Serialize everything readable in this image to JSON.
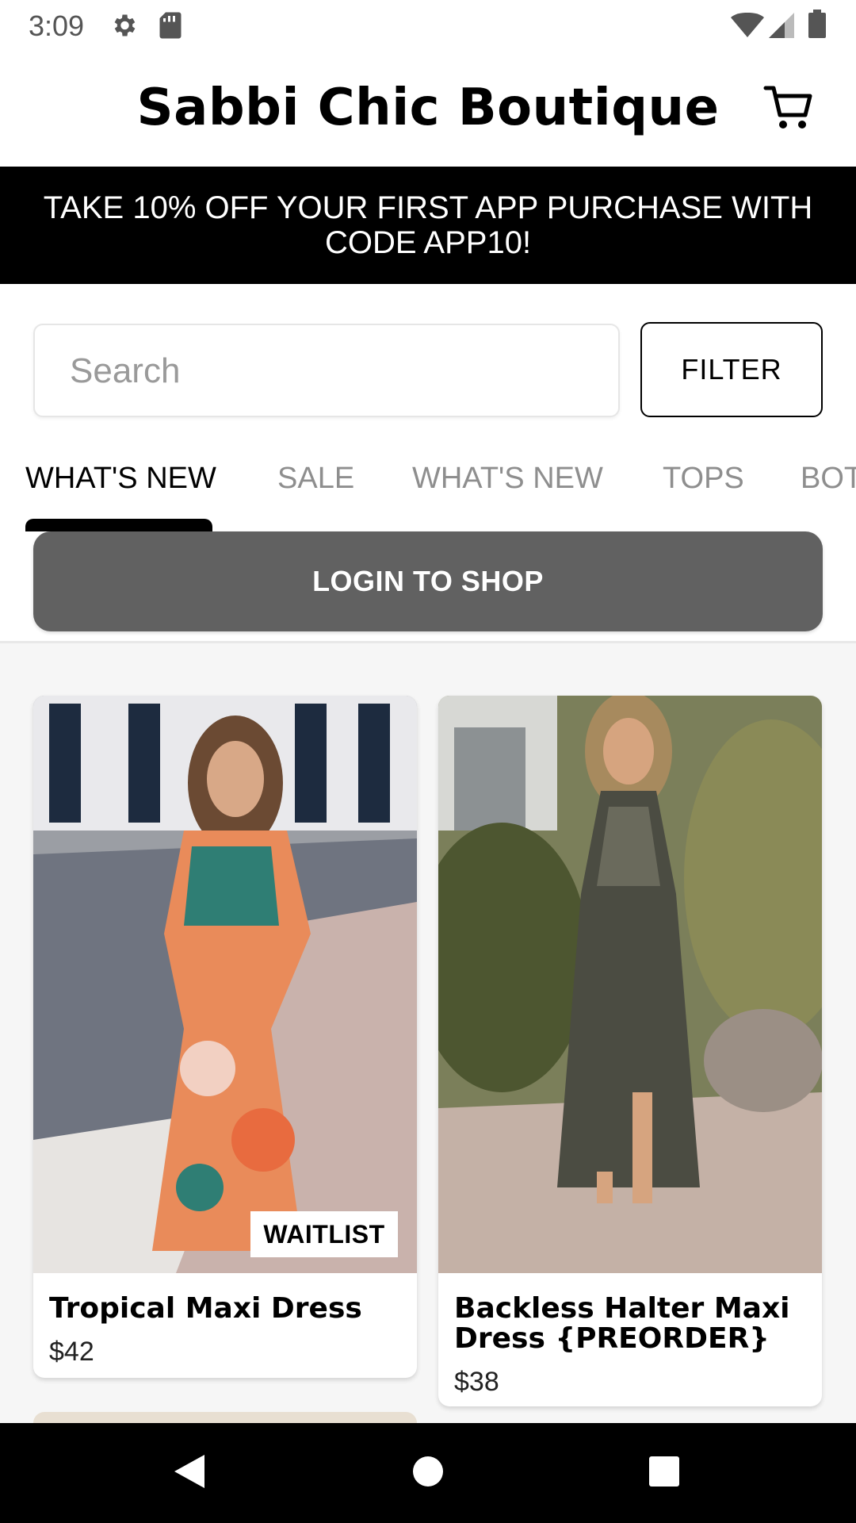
{
  "status_bar": {
    "time": "3:09",
    "icons": [
      "gear-icon",
      "sd-card-icon",
      "wifi-icon",
      "signal-icon",
      "battery-icon"
    ]
  },
  "header": {
    "title": "Sabbi Chic Boutique",
    "cart_icon": "cart-icon"
  },
  "promo": {
    "text": "TAKE 10% OFF YOUR FIRST APP PURCHASE WITH CODE APP10!"
  },
  "search": {
    "placeholder": "Search",
    "value": ""
  },
  "filter": {
    "label": "FILTER"
  },
  "tabs": [
    {
      "label": "WHAT'S NEW",
      "active": true
    },
    {
      "label": "SALE",
      "active": false
    },
    {
      "label": "WHAT'S NEW",
      "active": false
    },
    {
      "label": "TOPS",
      "active": false
    },
    {
      "label": "BOT",
      "active": false
    }
  ],
  "login": {
    "label": "LOGIN TO SHOP"
  },
  "products": [
    {
      "name": "Tropical Maxi Dress",
      "price": "$42",
      "badge": "WAITLIST"
    },
    {
      "name": "Backless Halter Maxi Dress {PREORDER}",
      "price": "$38",
      "badge": ""
    }
  ],
  "nav": {
    "icons": [
      "back-icon",
      "home-icon",
      "recents-icon"
    ]
  },
  "colors": {
    "accent": "#000000",
    "login_button": "#616161",
    "inactive_tab": "#8e8e8e",
    "content_bg": "#f6f6f6"
  }
}
